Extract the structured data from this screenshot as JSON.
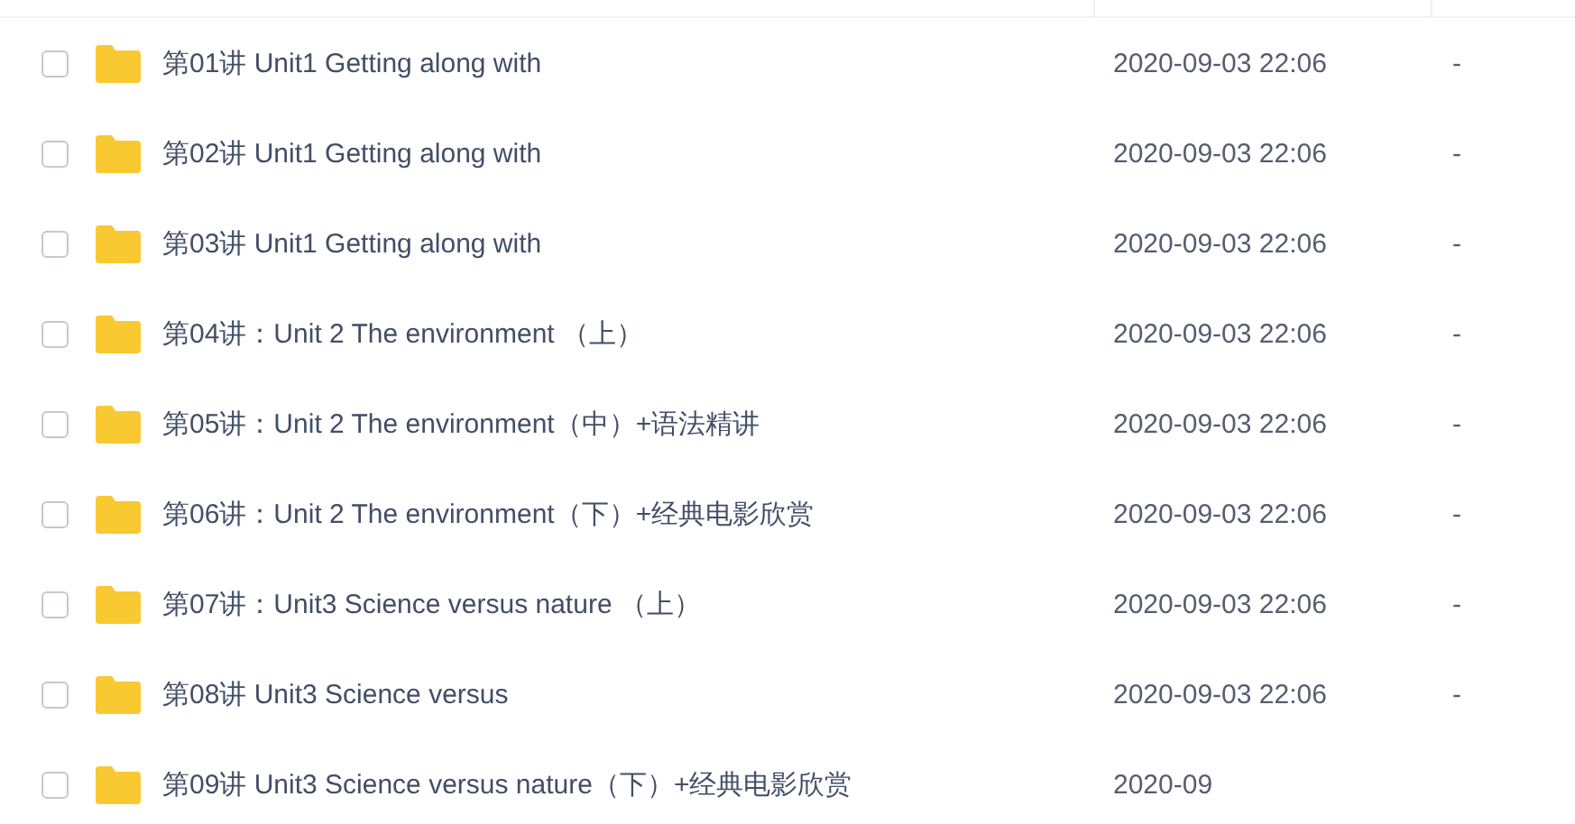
{
  "rows": [
    {
      "name": "第01讲 Unit1 Getting along with",
      "checked": false,
      "modified": "2020-09-03 22:06",
      "size": "-"
    },
    {
      "name": "第02讲 Unit1 Getting along with",
      "checked": false,
      "modified": "2020-09-03 22:06",
      "size": "-"
    },
    {
      "name": "第03讲 Unit1 Getting along with",
      "checked": false,
      "modified": "2020-09-03 22:06",
      "size": "-"
    },
    {
      "name": "第04讲：Unit 2 The environment （上）",
      "checked": false,
      "modified": "2020-09-03 22:06",
      "size": "-"
    },
    {
      "name": "第05讲：Unit 2 The environment（中）+语法精讲",
      "checked": false,
      "modified": "2020-09-03 22:06",
      "size": "-"
    },
    {
      "name": "第06讲：Unit 2 The environment（下）+经典电影欣赏",
      "checked": false,
      "modified": "2020-09-03 22:06",
      "size": "-"
    },
    {
      "name": "第07讲：Unit3 Science versus nature （上）",
      "checked": false,
      "modified": "2020-09-03 22:06",
      "size": "-"
    },
    {
      "name": "第08讲 Unit3 Science versus",
      "checked": false,
      "modified": "2020-09-03 22:06",
      "size": "-"
    },
    {
      "name": "第09讲 Unit3 Science versus nature（下）+经典电影欣赏",
      "checked": false,
      "modified": "2020-09"
    }
  ]
}
